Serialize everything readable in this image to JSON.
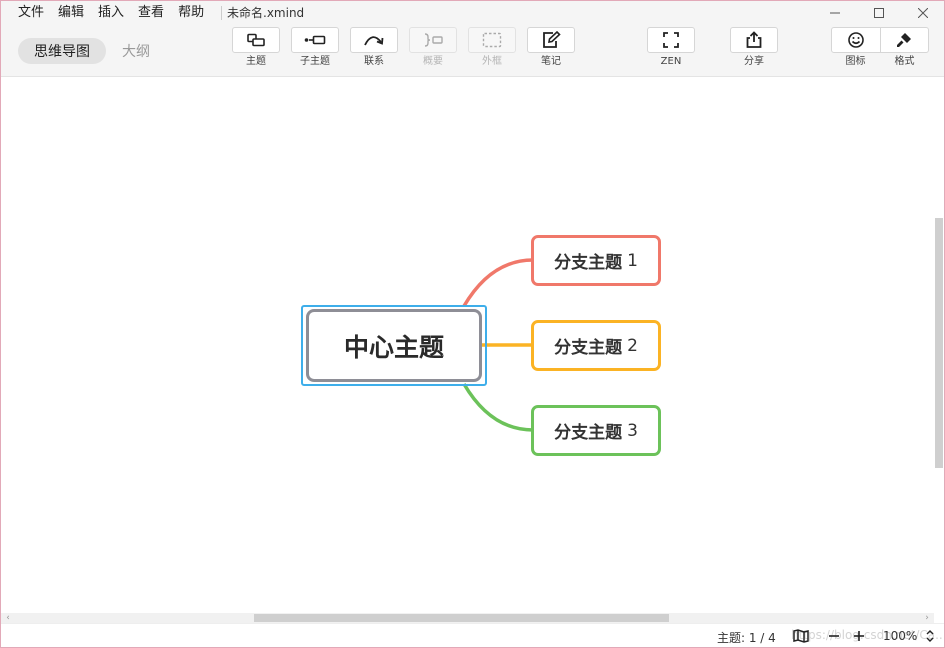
{
  "menu": [
    "文件",
    "编辑",
    "插入",
    "查看",
    "帮助"
  ],
  "window_title": "未命名.xmind",
  "views": {
    "active": "思维导图",
    "inactive": "大纲"
  },
  "tools": {
    "topic": "主题",
    "subtopic": "子主题",
    "relationship": "联系",
    "summary": "概要",
    "boundary": "外框",
    "note": "笔记",
    "zen": "ZEN",
    "share": "分享",
    "icon": "图标",
    "format": "格式"
  },
  "map": {
    "central": "中心主题",
    "branches": [
      {
        "label": "分支主题",
        "num": "1",
        "color": "#f0786a"
      },
      {
        "label": "分支主题",
        "num": "2",
        "color": "#fbb324"
      },
      {
        "label": "分支主题",
        "num": "3",
        "color": "#6cc25a"
      }
    ]
  },
  "status": {
    "topic_count": "主题: 1 / 4",
    "zoom": "100%",
    "watermark": "https://blog.csdn.net/Ca..."
  },
  "colors": {
    "selection": "#3eaeea",
    "central_border": "#8e8e96"
  }
}
